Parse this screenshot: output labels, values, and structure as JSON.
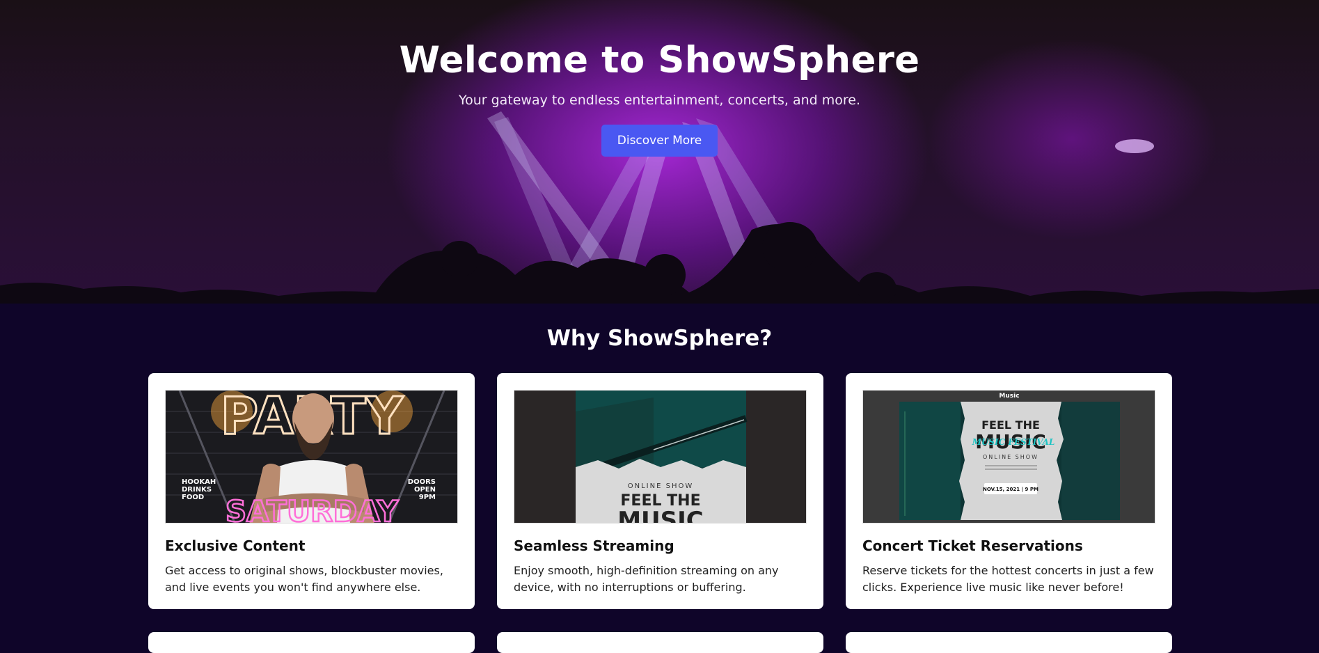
{
  "hero": {
    "title": "Welcome to ShowSphere",
    "subtitle": "Your gateway to endless entertainment, concerts, and more.",
    "button_label": "Discover More"
  },
  "features": {
    "title": "Why ShowSphere?",
    "cards": [
      {
        "title": "Exclusive Content",
        "text": "Get access to original shows, blockbuster movies, and live events you won't find anywhere else.",
        "image": {
          "kind": "party-saturday-poster",
          "headline": "PARTY",
          "footer": "SATURDAY",
          "left_lines": [
            "HOOKAH",
            "DRINKS",
            "FOOD"
          ],
          "right_lines": [
            "DOORS",
            "OPEN",
            "9PM"
          ]
        }
      },
      {
        "title": "Seamless Streaming",
        "text": "Enjoy smooth, high-definition streaming on any device, with no interruptions or buffering.",
        "image": {
          "kind": "feel-the-music-poster-portrait",
          "kicker": "ONLINE SHOW",
          "headline_1": "FEEL THE",
          "headline_2": "MUSIC"
        }
      },
      {
        "title": "Concert Ticket Reservations",
        "text": "Reserve tickets for the hottest concerts in just a few clicks. Experience live music like never before!",
        "image": {
          "kind": "feel-the-music-poster-landscape",
          "top_label": "Music",
          "headline_1": "FEEL THE",
          "headline_2": "MUSIC",
          "accent": "MUSIC FESTIVAL",
          "kicker": "ONLINE SHOW",
          "date": "NOV.15, 2021 | 9 PM"
        }
      }
    ]
  },
  "colors": {
    "page_bg": "#0f0529",
    "accent_button": "#4a58f2",
    "hero_purple": "#a828dc",
    "card_bg": "#ffffff",
    "teal_accent": "#1fc3c3",
    "neon_pink": "#ff4fd2",
    "neon_orange": "#ffb347"
  }
}
